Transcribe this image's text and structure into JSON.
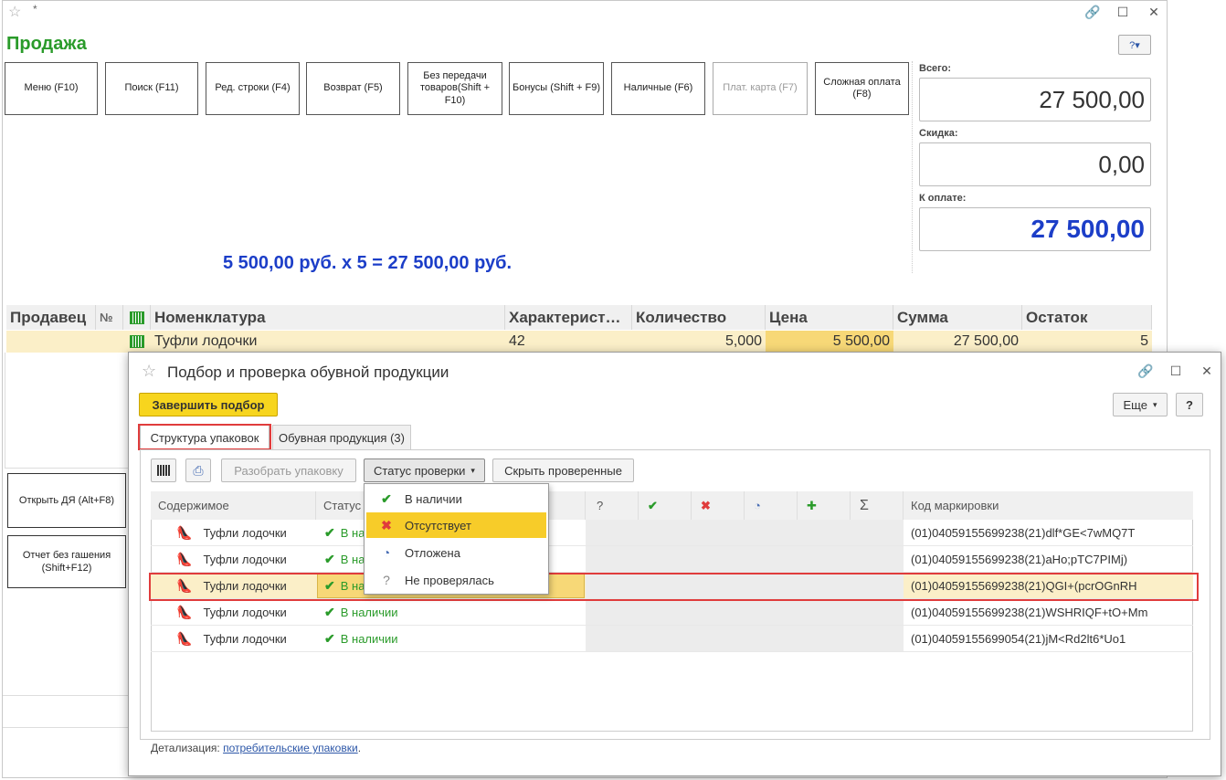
{
  "main": {
    "title": "Продажа",
    "title_marker": "*",
    "fkeys": [
      {
        "label": "Меню (F10)",
        "disabled": false
      },
      {
        "label": "Поиск (F11)",
        "disabled": false
      },
      {
        "label": "Ред. строки (F4)",
        "disabled": false
      },
      {
        "label": "Возврат (F5)",
        "disabled": false
      },
      {
        "label": "Без передачи товаров(Shift + F10)",
        "disabled": false
      },
      {
        "label": "Бонусы (Shift + F9)",
        "disabled": false
      },
      {
        "label": "Наличные (F6)",
        "disabled": false
      },
      {
        "label": "Плат. карта (F7)",
        "disabled": true
      },
      {
        "label": "Сложная оплата (F8)",
        "disabled": false
      }
    ],
    "totals": {
      "total_label": "Всего:",
      "total_value": "27 500,00",
      "discount_label": "Скидка:",
      "discount_value": "0,00",
      "pay_label": "К оплате:",
      "pay_value": "27 500,00"
    },
    "calc_line": "5 500,00 руб. x 5  = 27 500,00 руб.",
    "side_buttons": {
      "open_dya": "Открыть ДЯ (Alt+F8)",
      "report": "Отчет без гашения (Shift+F12)"
    },
    "table": {
      "headers": {
        "seller": "Продавец",
        "number": "№",
        "nomenclature": "Номенклатура",
        "characteristic": "Характерист…",
        "quantity": "Количество",
        "price": "Цена",
        "sum": "Сумма",
        "remainder": "Остаток"
      },
      "row": {
        "seller": "",
        "number": "",
        "nomenclature": "Туфли лодочки",
        "characteristic": "42",
        "quantity": "5,000",
        "price": "5 500,00",
        "sum": "27 500,00",
        "remainder": "5"
      }
    }
  },
  "dialog": {
    "title": "Подбор и проверка обувной продукции",
    "finish_button": "Завершить подбор",
    "more_button": "Еще",
    "help_button": "?",
    "tabs": [
      {
        "label": "Структура упаковок",
        "active": true
      },
      {
        "label": "Обувная продукция (3)",
        "active": false
      }
    ],
    "toolbar": {
      "unpack": "Разобрать упаковку",
      "status_check": "Статус проверки",
      "hide_checked": "Скрыть проверенные"
    },
    "columns": {
      "content": "Содержимое",
      "status": "Статус",
      "q": "?",
      "ok": "✔",
      "x": "✖",
      "deferred": "◔",
      "plus": "✚",
      "sum": "Σ",
      "code": "Код маркировки"
    },
    "rows": [
      {
        "content": "Туфли лодочки",
        "status": "В наличии",
        "code": "(01)04059155699238(21)dlf*GE<7wMQ7T",
        "selected": false
      },
      {
        "content": "Туфли лодочки",
        "status": "В наличии",
        "code": "(01)04059155699238(21)aHo;pTC7PIMj)",
        "selected": false
      },
      {
        "content": "Туфли лодочки",
        "status": "В наличии",
        "code": "(01)04059155699238(21)QGI+(pcrOGnRH",
        "selected": true
      },
      {
        "content": "Туфли лодочки",
        "status": "В наличии",
        "code": "(01)04059155699238(21)WSHRIQF+tO+Mm",
        "selected": false
      },
      {
        "content": "Туфли лодочки",
        "status": "В наличии",
        "code": "(01)04059155699054(21)jM<Rd2lt6*Uo1",
        "selected": false
      }
    ],
    "dropdown": [
      {
        "label": "В наличии",
        "icon": "check-icon",
        "color": "#2a9b2a"
      },
      {
        "label": "Отсутствует",
        "icon": "cross-icon",
        "color": "#e03c3c",
        "active": true
      },
      {
        "label": "Отложена",
        "icon": "pie-icon",
        "color": "#4a6fb5"
      },
      {
        "label": "Не проверялась",
        "icon": "question-icon",
        "color": "#888888"
      }
    ],
    "footer": {
      "label": "Детализация:",
      "link": "потребительские упаковки",
      "end": "."
    }
  },
  "colors": {
    "title_green": "#2a9b2a",
    "calc_blue": "#1c3ec8",
    "selection_yellow": "#fbefc8",
    "accent_yellow": "#f7d51e",
    "highlight_red": "#e03c3c"
  }
}
